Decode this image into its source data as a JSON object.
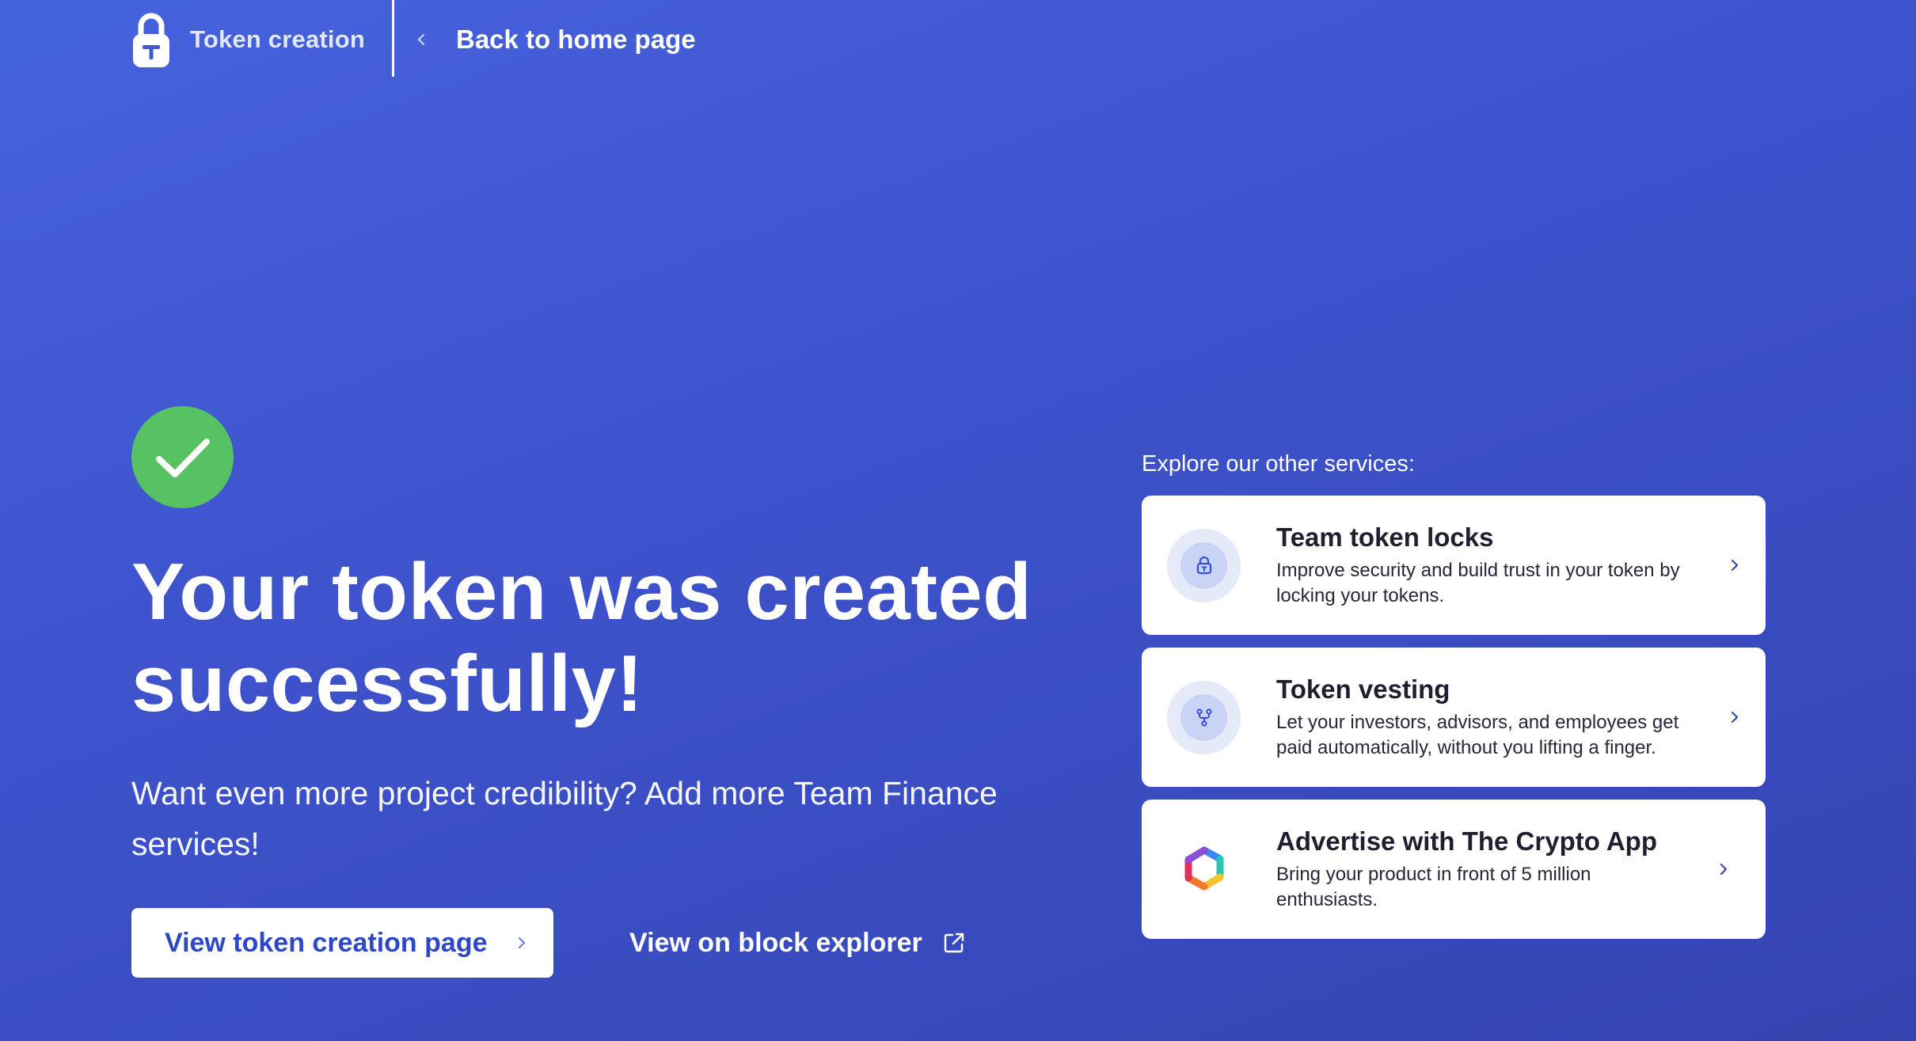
{
  "header": {
    "brand_name": "Token creation",
    "back_link_label": "Back to home page"
  },
  "main": {
    "headline": "Your token was created successfully!",
    "subtext": "Want even more project credibility? Add more Team Finance services!",
    "primary_button_label": "View token creation page",
    "secondary_link_label": "View on block explorer"
  },
  "services": {
    "heading": "Explore our other services:",
    "items": [
      {
        "title": "Team token locks",
        "description": "Improve security and build trust in your token by locking your tokens.",
        "icon": "lock-icon"
      },
      {
        "title": "Token vesting",
        "description": "Let your investors, advisors, and employees get paid automatically, without you lifting a finger.",
        "icon": "vesting-icon"
      },
      {
        "title": "Advertise with The Crypto App",
        "description": "Bring your product in front of 5 million enthusiasts.",
        "icon": "crypto-app-logo"
      }
    ]
  },
  "colors": {
    "background": "#3f55cf",
    "success": "#56c263",
    "accent": "#2e47c8",
    "card": "#ffffff"
  }
}
